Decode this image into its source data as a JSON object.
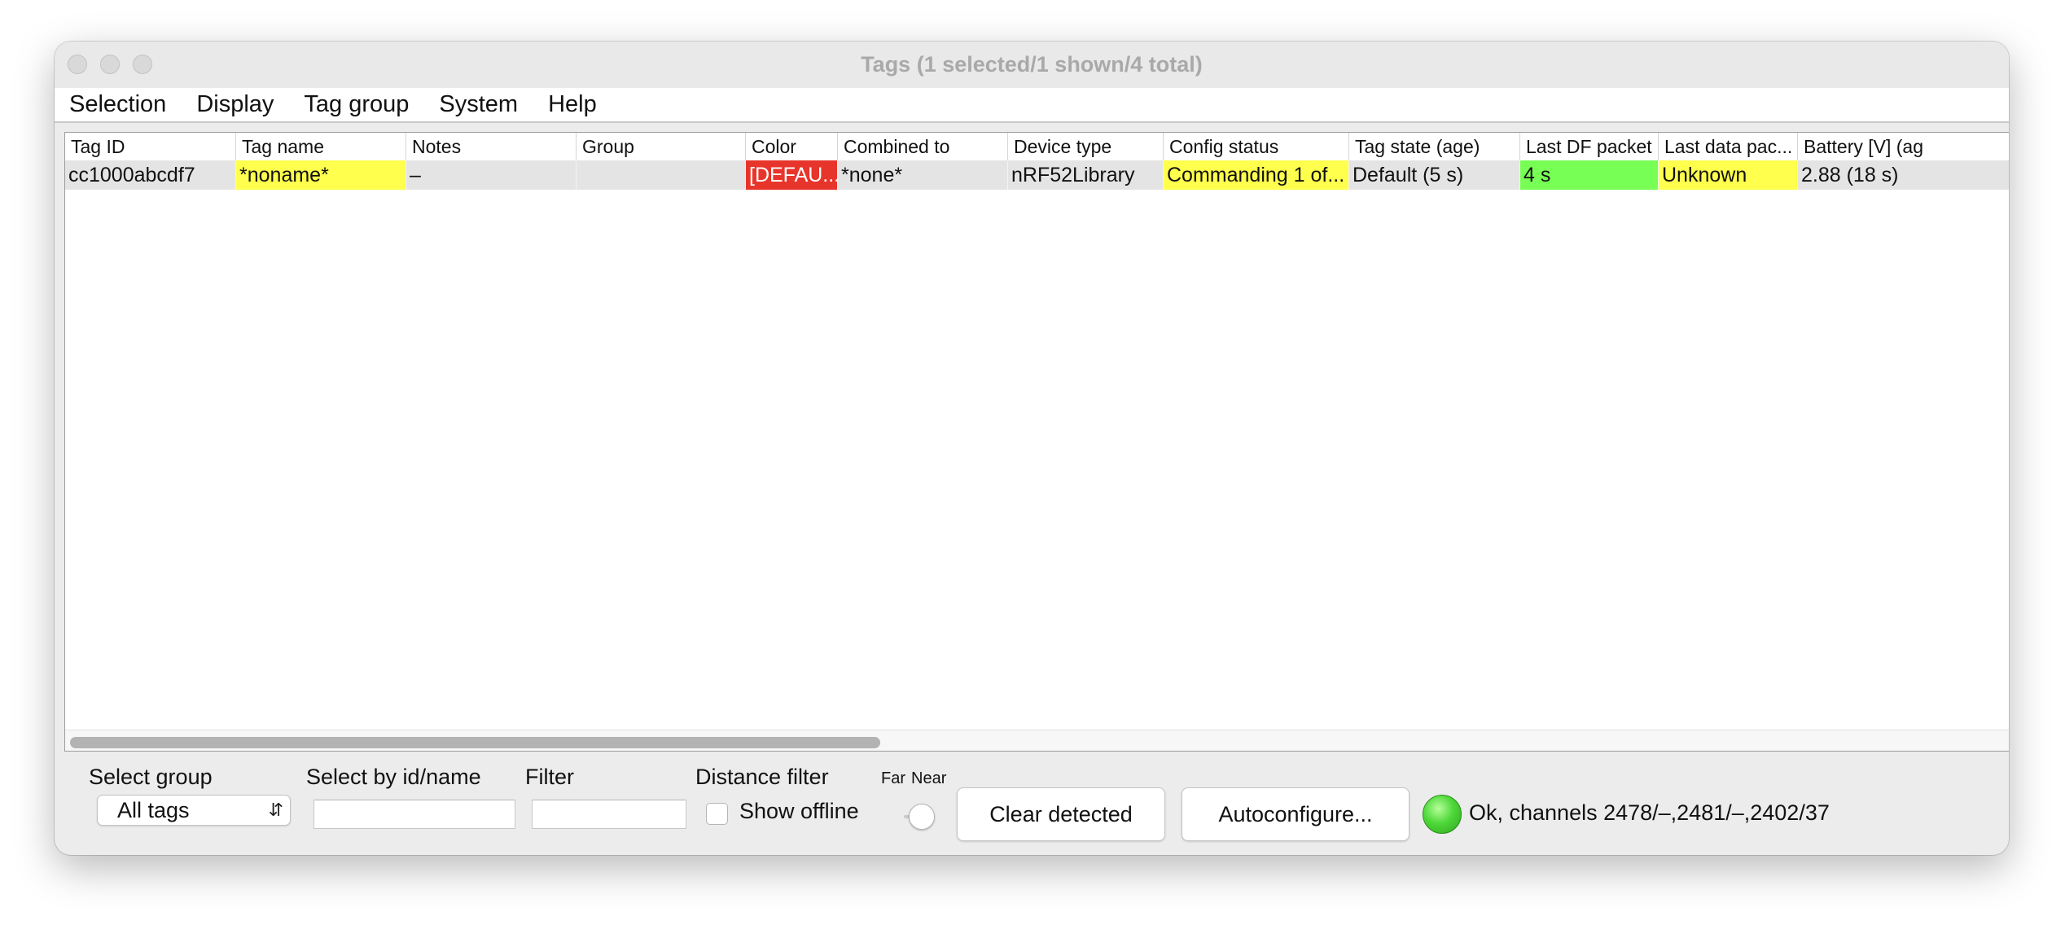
{
  "window": {
    "title": "Tags (1 selected/1 shown/4 total)"
  },
  "menubar": {
    "items": [
      "Selection",
      "Display",
      "Tag group",
      "System",
      "Help"
    ]
  },
  "table": {
    "columns": [
      "Tag ID",
      "Tag name",
      "Notes",
      "Group",
      "Color",
      "Combined to",
      "Device type",
      "Config status",
      "Tag state (age)",
      "Last DF packet",
      "Last data pac...",
      "Battery [V] (ag"
    ],
    "rows": [
      {
        "cells": [
          "cc1000abcdf7",
          "*noname*",
          "–",
          "",
          "[DEFAU...",
          "*none*",
          "nRF52Library",
          "Commanding 1 of...",
          "Default (5 s)",
          "4 s",
          "Unknown",
          "2.88 (18 s)"
        ],
        "cell_colors": {
          "tag_name": "#ffff4d",
          "color": "#e8352b",
          "config_status": "#ffff4d",
          "last_df_packet": "#77ff55",
          "last_data_packet": "#ffff4d"
        }
      }
    ]
  },
  "controls": {
    "select_group_label": "Select group",
    "select_group_value": "All tags",
    "select_by_label": "Select by id/name",
    "select_by_value": "",
    "filter_label": "Filter",
    "filter_value": "",
    "distance_filter_label": "Distance filter",
    "show_offline_label": "Show offline",
    "show_offline_checked": false,
    "far_label": "Far",
    "near_label": "Near",
    "clear_detected_label": "Clear detected",
    "autoconfigure_label": "Autoconfigure...",
    "status_text": "Ok, channels 2478/–,2481/–,2402/37",
    "status_color": "#4fd83a"
  }
}
